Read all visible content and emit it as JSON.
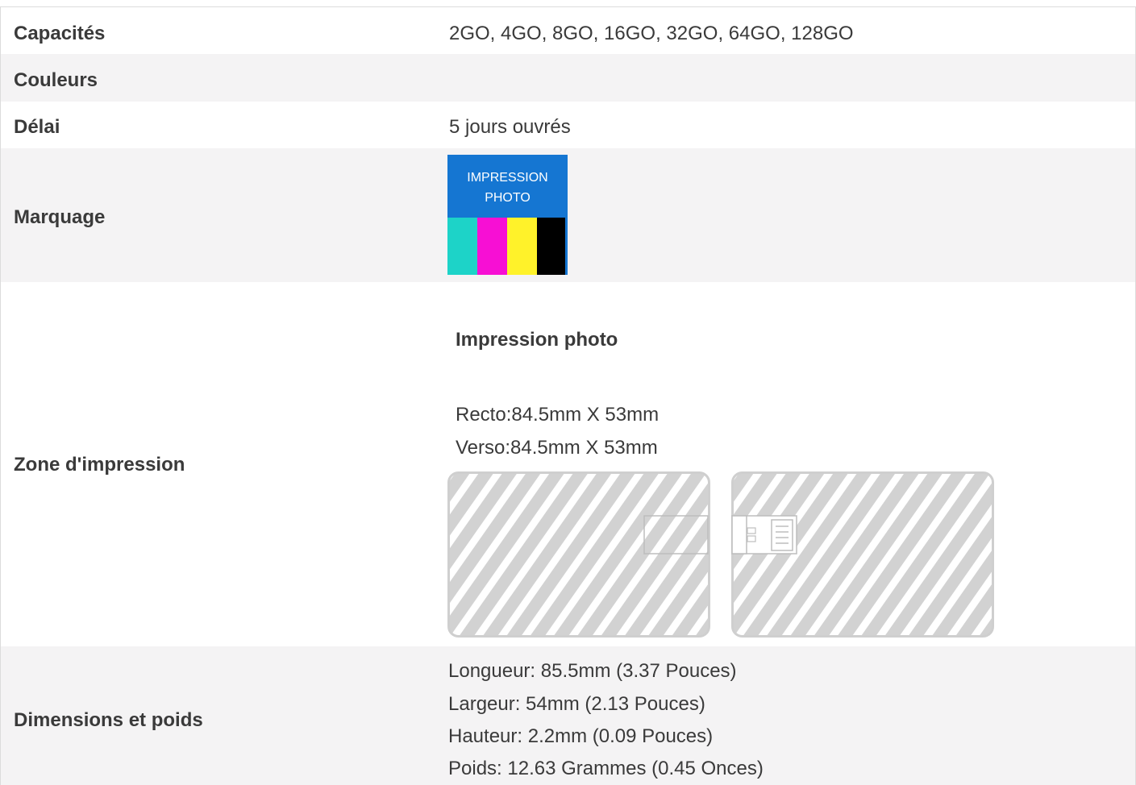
{
  "rows": {
    "capacites": {
      "label": "Capacités",
      "value": "2GO, 4GO, 8GO, 16GO, 32GO, 64GO, 128GO"
    },
    "couleurs": {
      "label": "Couleurs",
      "value": ""
    },
    "delai": {
      "label": "Délai",
      "value": "5 jours ouvrés"
    },
    "marquage": {
      "label": "Marquage",
      "badge_line1": "IMPRESSION",
      "badge_line2": "PHOTO",
      "badge_color": "#1576d2",
      "cmyk_colors": [
        "#1dd3c8",
        "#f70fd4",
        "#fff22a",
        "#000000"
      ]
    },
    "zone": {
      "label": "Zone d'impression",
      "title": "Impression photo",
      "recto": "Recto:84.5mm X 53mm",
      "verso": "Verso:84.5mm X 53mm"
    },
    "dimensions": {
      "label": "Dimensions et poids",
      "longueur": "Longueur: 85.5mm (3.37 Pouces)",
      "largeur": "Largeur: 54mm (2.13 Pouces)",
      "hauteur": "Hauteur: 2.2mm (0.09 Pouces)",
      "poids": "Poids: 12.63 Grammes (0.45 Onces)"
    }
  }
}
